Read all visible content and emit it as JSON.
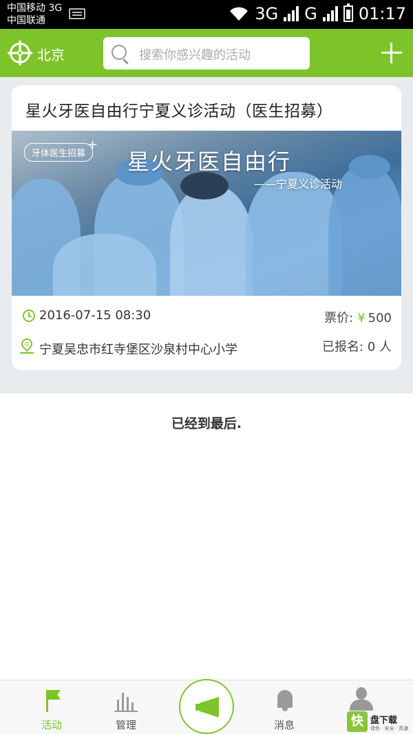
{
  "status_bar": {
    "carrier_1": "中国移动 3G",
    "carrier_2": "中国联通",
    "net_1": "3G",
    "net_2": "G",
    "time": "01:17"
  },
  "header": {
    "city": "北京",
    "search_placeholder": "搜索你感兴趣的活动",
    "accent_color": "#7dc42a"
  },
  "event": {
    "title": "星火牙医自由行宁夏义诊活动（医生招募）",
    "banner_tag": "牙体医生招募",
    "banner_title": "星火牙医自由行",
    "banner_subtitle": "——宁夏义诊活动",
    "datetime": "2016-07-15 08:30",
    "price_label": "票价:",
    "price_currency": "¥",
    "price_value": "500",
    "address": "宁夏吴忠市红寺堡区沙泉村中心小学",
    "signup_text": "已报名: 0 人"
  },
  "list_end_text": "已经到最后.",
  "bottom_nav": {
    "items": [
      {
        "label": "活动",
        "icon": "flag-icon",
        "active": true
      },
      {
        "label": "管理",
        "icon": "bar-chart-icon",
        "active": false
      },
      {
        "label": "",
        "icon": "megaphone-icon",
        "active": false
      },
      {
        "label": "消息",
        "icon": "bell-icon",
        "active": false
      },
      {
        "label": "",
        "icon": "user-icon",
        "active": false
      }
    ]
  },
  "watermark": {
    "logo": "快",
    "text": "盘下载",
    "subtext": "绿色 · 安全 · 高速"
  }
}
